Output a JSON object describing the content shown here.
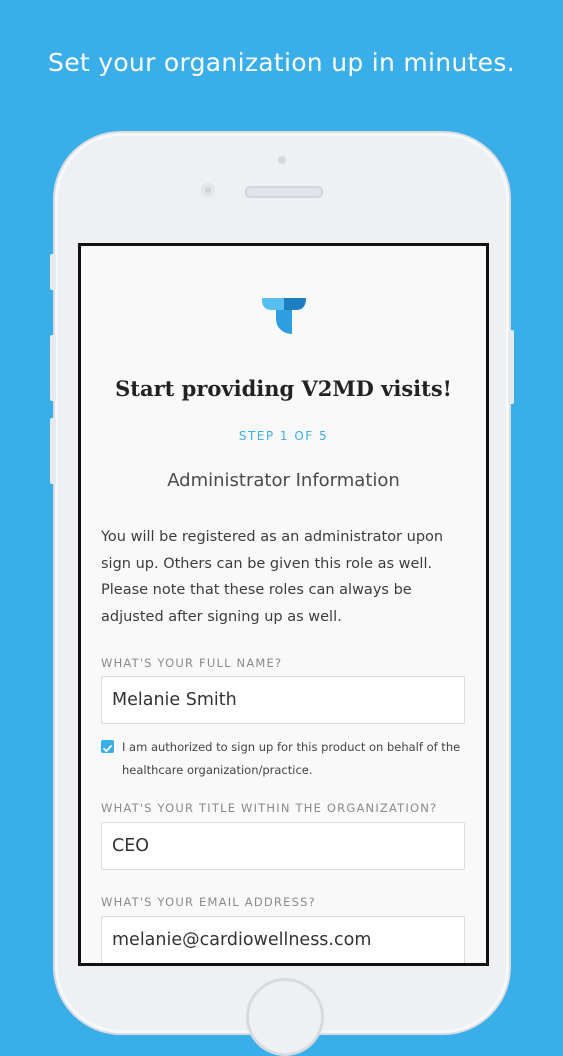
{
  "headline": "Set your organization up in minutes.",
  "form": {
    "title": "Start providing V2MD visits!",
    "step": "STEP 1 OF 5",
    "section": "Administrator Information",
    "description": "You will be registered as an administrator upon sign up. Others can be given this role as well. Please note that these roles can always be adjusted after signing up as well.",
    "full_name_label": "WHAT'S YOUR FULL NAME?",
    "full_name_value": "Melanie Smith",
    "authorized_checked": true,
    "authorized_label": "I am authorized to sign up for this product on behalf of the healthcare organization/practice.",
    "title_label": "WHAT'S YOUR TITLE WITHIN THE ORGANIZATION?",
    "title_value": "CEO",
    "email_label": "WHAT'S YOUR EMAIL ADDRESS?",
    "email_value": "melanie@cardiowellness.com"
  },
  "colors": {
    "background": "#3aaee9",
    "accent": "#3aaee9",
    "logo_dark": "#1c7fc2"
  },
  "icons": {
    "logo": "v2md-logo-icon",
    "checkbox": "checkmark-icon"
  }
}
